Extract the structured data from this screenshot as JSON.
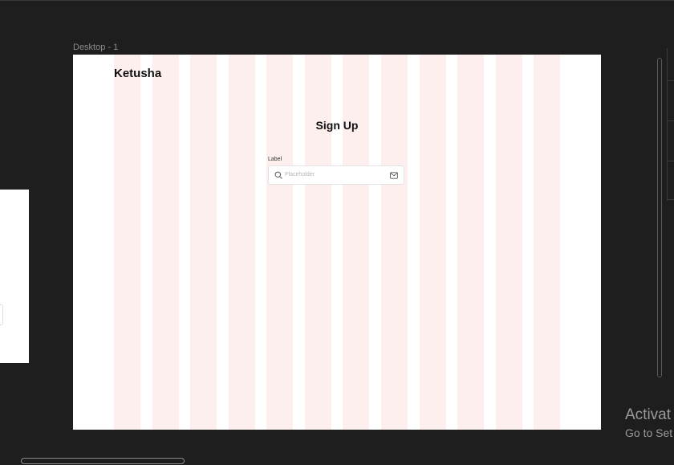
{
  "frame": {
    "label": "Desktop - 1"
  },
  "page": {
    "logo": "Ketusha",
    "title": "Sign Up",
    "field": {
      "label": "Label",
      "placeholder": "Placeholder",
      "leading_icon": "search-icon",
      "trailing_icon": "mail-icon"
    }
  },
  "layout_grid": {
    "columns": 12,
    "color": "#fcefee"
  },
  "watermark": {
    "line1": "Activat",
    "line2": "Go to Set"
  },
  "colors": {
    "canvas_bg": "#1e1e1e",
    "frame_bg": "#ffffff",
    "grid_column": "#fcefee",
    "text": "#111111"
  }
}
